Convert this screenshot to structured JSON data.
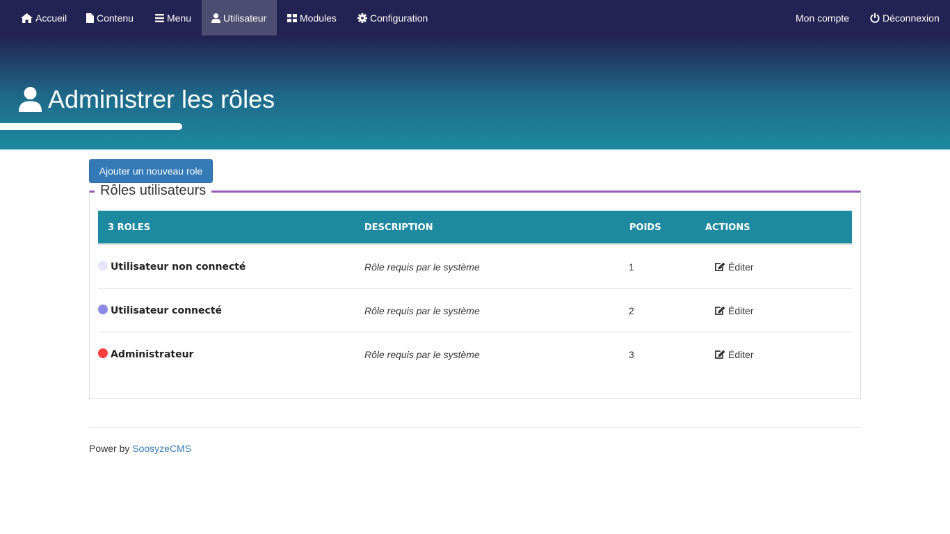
{
  "nav": {
    "left": [
      {
        "label": "Accueil",
        "icon": "home-icon"
      },
      {
        "label": "Contenu",
        "icon": "file-icon"
      },
      {
        "label": "Menu",
        "icon": "bars-icon"
      },
      {
        "label": "Utilisateur",
        "icon": "user-icon",
        "active": true
      },
      {
        "label": "Modules",
        "icon": "grid-icon"
      },
      {
        "label": "Configuration",
        "icon": "gear-icon"
      }
    ],
    "right": [
      {
        "label": "Mon compte"
      },
      {
        "label": "Déconnexion",
        "icon": "power-icon"
      }
    ]
  },
  "page": {
    "title": "Administrer les rôles",
    "title_icon": "user-icon"
  },
  "actions": {
    "add_role_label": "Ajouter un nouveau role"
  },
  "roles_section": {
    "legend": "Rôles utilisateurs",
    "columns": [
      "3 roles",
      "Description",
      "Poids",
      "Actions"
    ],
    "rows": [
      {
        "name": "Utilisateur non connecté",
        "color": "#e6e6fa",
        "description": "Rôle requis par le système",
        "weight": "1",
        "action": "Éditer"
      },
      {
        "name": "Utilisateur connecté",
        "color": "#8a8ae6",
        "description": "Rôle requis par le système",
        "weight": "2",
        "action": "Éditer"
      },
      {
        "name": "Administrateur",
        "color": "#ff4040",
        "description": "Rôle requis par le système",
        "weight": "3",
        "action": "Éditer"
      }
    ]
  },
  "footer": {
    "prefix": "Power by",
    "link_label": "SoosyzeCMS"
  },
  "colors": {
    "nav_bg": "#232353",
    "header_gradient_end": "#1e8aa0",
    "table_header": "#1e8aa0",
    "legend_accent": "#9b59b6",
    "primary_button": "#337ab7"
  }
}
